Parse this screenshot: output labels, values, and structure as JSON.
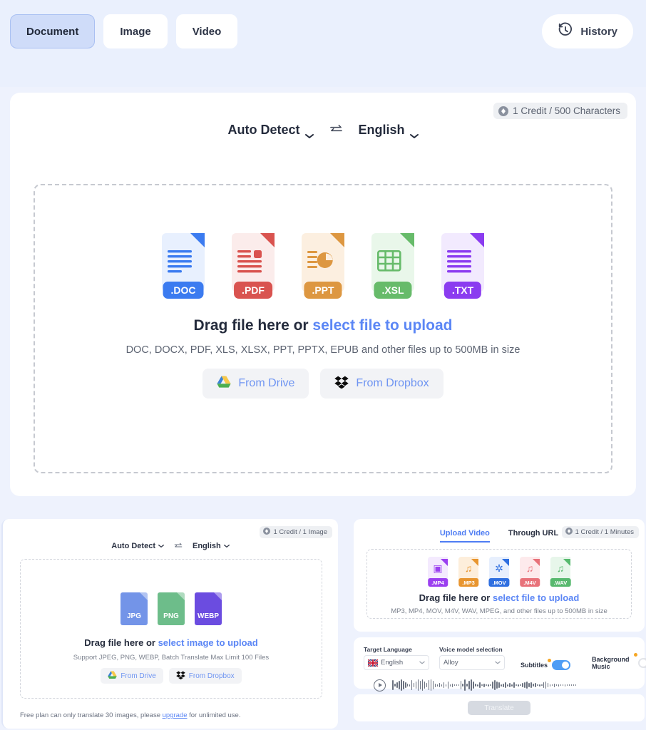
{
  "topbar": {
    "tabs": [
      {
        "label": "Document",
        "active": true
      },
      {
        "label": "Image",
        "active": false
      },
      {
        "label": "Video",
        "active": false
      }
    ],
    "history_label": "History",
    "history_icon": "clock-rewind-icon"
  },
  "document_panel": {
    "credit_badge": "1 Credit / 500 Characters",
    "source_language": "Auto Detect",
    "swap_icon": "swap-arrows-icon",
    "target_language": "English",
    "file_types": [
      {
        "label": ".DOC",
        "color": "#3b7bf0",
        "page": "#e8f0fe",
        "fold": "#3b7bf0",
        "glyph": "lines"
      },
      {
        "label": ".PDF",
        "color": "#d9534f",
        "page": "#fbeceb",
        "fold": "#d9534f",
        "glyph": "lines-box"
      },
      {
        "label": ".PPT",
        "color": "#dd9741",
        "page": "#fcefe0",
        "fold": "#dd9741",
        "glyph": "pie"
      },
      {
        "label": ".XSL",
        "color": "#67bb6a",
        "page": "#e9f7ea",
        "fold": "#67bb6a",
        "glyph": "grid"
      },
      {
        "label": ".TXT",
        "color": "#8b3cf0",
        "page": "#f2eafe",
        "fold": "#8b3cf0",
        "glyph": "lines"
      }
    ],
    "drop_prefix": "Drag file here or ",
    "drop_link": "select file to upload",
    "drop_sub": "DOC, DOCX, PDF, XLS, XLSX, PPT, PPTX, EPUB and other files up to 500MB in size",
    "drive_label": "From Drive",
    "dropbox_label": "From Dropbox"
  },
  "image_panel": {
    "credit_badge": "1 Credit / 1 Image",
    "source_language": "Auto Detect",
    "target_language": "English",
    "file_types": [
      {
        "label": "JPG",
        "color": "#7394e8"
      },
      {
        "label": "PNG",
        "color": "#6dbd8a"
      },
      {
        "label": "WEBP",
        "color": "#6b4ce0"
      }
    ],
    "drop_prefix": "Drag file here or ",
    "drop_link": "select image to upload",
    "drop_sub": "Support JPEG, PNG, WEBP, Batch Translate Max Limit 100 Files",
    "drive_label": "From Drive",
    "dropbox_label": "From Dropbox",
    "plan_note_prefix": "Free plan can only translate 30 images, please ",
    "plan_note_link": "upgrade",
    "plan_note_suffix": " for unlimited use."
  },
  "video_panel": {
    "credit_badge": "1 Credit / 1 Minutes",
    "tabs": [
      {
        "label": "Upload Video",
        "active": true
      },
      {
        "label": "Through URL",
        "active": false
      }
    ],
    "file_types": [
      {
        "label": ".MP4",
        "color": "#9b3ff0",
        "page": "#f4eafe",
        "fold": "#9b3ff0",
        "glyph": "▣"
      },
      {
        "label": ".MP3",
        "color": "#e8952f",
        "page": "#fdeedb",
        "fold": "#e8952f",
        "glyph": "♫"
      },
      {
        "label": ".MOV",
        "color": "#2f6fe0",
        "page": "#e7effd",
        "fold": "#2f6fe0",
        "glyph": "✲"
      },
      {
        "label": ".M4V",
        "color": "#e8727a",
        "page": "#fdeaec",
        "fold": "#e8727a",
        "glyph": "♫"
      },
      {
        "label": ".WAV",
        "color": "#57b96e",
        "page": "#e7f6ea",
        "fold": "#57b96e",
        "glyph": "♫"
      }
    ],
    "drop_prefix": "Drag file here or ",
    "drop_link": "select file to upload",
    "drop_sub": "MP3, MP4, MOV, M4V, WAV, MPEG, and other files up to 500MB in size",
    "settings": {
      "target_language_label": "Target Language",
      "target_language_value": "English",
      "voice_model_label": "Voice model selection",
      "voice_model_value": "Alloy",
      "subtitles_label": "Subtitles",
      "subtitles_on": true,
      "background_music_label": "Background Music",
      "background_music_on": false
    },
    "play_icon": "play-circle-icon",
    "translate_label": "Translate"
  },
  "colors": {
    "page_bg": "#eaf0fd",
    "accent_blue": "#5b86f5",
    "toggle_on": "#4f9df5",
    "badge_orange": "#f5a623"
  }
}
